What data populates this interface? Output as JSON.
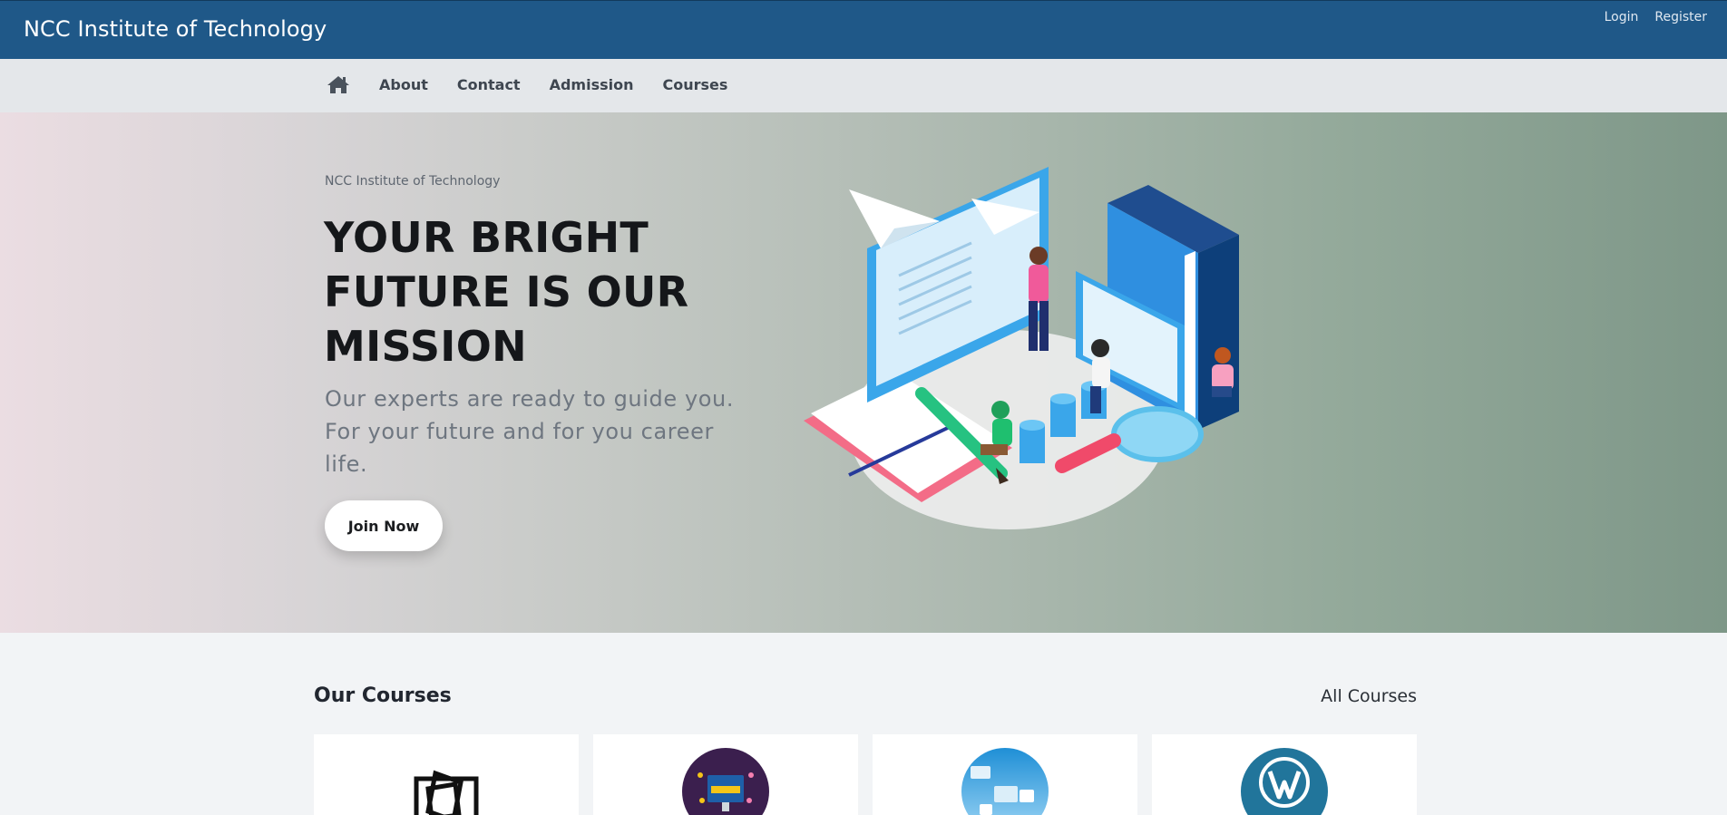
{
  "header": {
    "brand": "NCC Institute of Technology",
    "login_label": "Login",
    "register_label": "Register"
  },
  "nav": {
    "home_icon": "home-icon",
    "items": [
      {
        "label": "About"
      },
      {
        "label": "Contact"
      },
      {
        "label": "Admission"
      },
      {
        "label": "Courses"
      }
    ]
  },
  "hero": {
    "subtitle": "NCC Institute of Technology",
    "title": "YOUR BRIGHT FUTURE IS OUR MISSION",
    "text": "Our experts are ready to guide you. For your future and for you career life.",
    "button_label": "Join Now"
  },
  "courses": {
    "title": "Our Courses",
    "all_label": "All Courses",
    "cards": [
      {
        "image": "layers-outline-icon"
      },
      {
        "image": "full-stack-development-image"
      },
      {
        "image": "web-design-development-image"
      },
      {
        "image": "wordpress-logo"
      }
    ]
  },
  "colors": {
    "header_bg": "#1f5888",
    "nav_bg": "#e4e7ea",
    "page_bg": "#f2f4f6"
  }
}
